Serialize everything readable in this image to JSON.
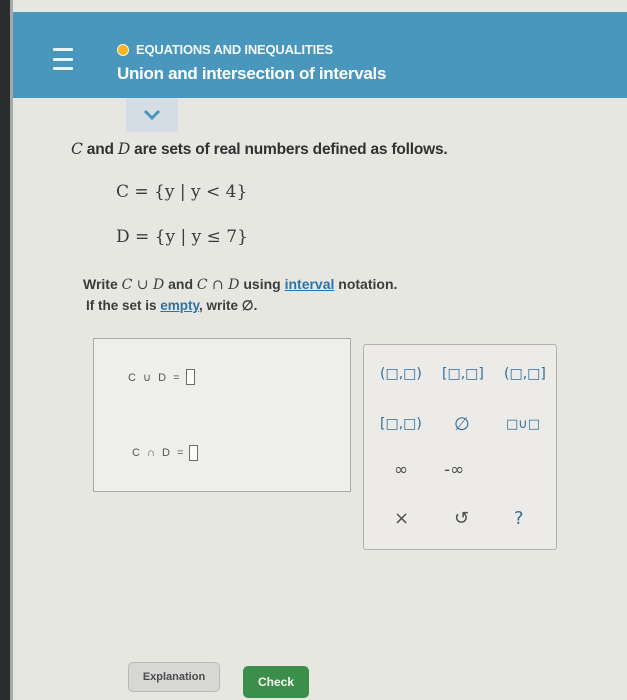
{
  "header": {
    "topic": "EQUATIONS AND INEQUALITIES",
    "title": "Union and intersection of intervals"
  },
  "problem": {
    "intro_c": "C",
    "intro_and": " and ",
    "intro_d": "D",
    "intro_rest": " are sets of real numbers defined as follows.",
    "set_c": "C = {y | y < 4}",
    "set_d": "D = {y | y ≤ 7}",
    "instruction_part1": "Write ",
    "instruction_union": "C ∪ D",
    "instruction_and": " and ",
    "instruction_inter": "C ∩ D",
    "instruction_using": " using ",
    "instruction_link": "interval",
    "instruction_end": " notation.",
    "empty_part1": "If the set is ",
    "empty_link": "empty",
    "empty_part2": ", write ∅."
  },
  "answers": {
    "union_label": "C ∪ D =",
    "intersection_label": "C ∩ D ="
  },
  "keypad": {
    "open_open": "(□,□)",
    "closed_closed": "[□,□]",
    "open_closed": "(□,□]",
    "closed_open": "[□,□)",
    "empty_set": "∅",
    "union": "□∪□",
    "infinity": "∞",
    "neg_infinity": "-∞",
    "clear": "×",
    "undo": "↺",
    "help": "?"
  },
  "buttons": {
    "explanation": "Explanation",
    "check": "Check"
  },
  "colors": {
    "header": "#4a97bd",
    "accent_link": "#2c74a6",
    "check_button": "#3c8f4a",
    "topic_dot": "#f4b426"
  }
}
